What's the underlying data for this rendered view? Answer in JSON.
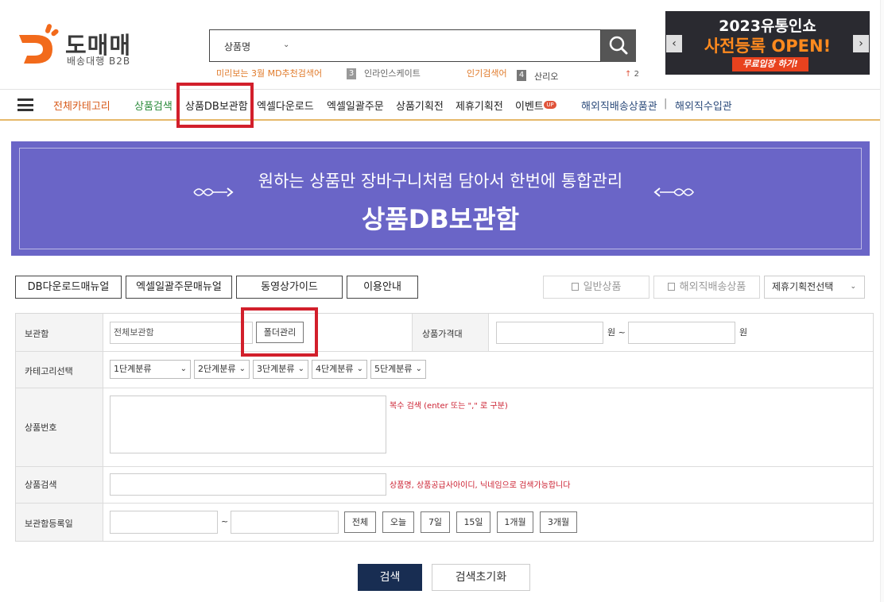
{
  "header": {
    "logo_title": "도매매",
    "logo_subtitle": "배송대행 B2B",
    "search_category": "상품명",
    "md_text": "미리보는 3월 MD추천검색어",
    "rank3_num": "3",
    "rank3_text": "인라인스케이트",
    "popular_label": "인기검색어",
    "rank4_num": "4",
    "rank4_text": "산리오",
    "rank4_change": "2"
  },
  "promo": {
    "line1": "2023유통인쇼",
    "line2": "사전등록 OPEN!",
    "button": "무료입장 하기!"
  },
  "nav": {
    "all": "전체카테고리",
    "search": "상품검색",
    "db": "상품DB보관함",
    "excel_download": "엑셀다운로드",
    "excel_order": "엑셀일괄주문",
    "planned": "상품기획전",
    "partner": "제휴기획전",
    "event": "이벤트",
    "event_badge": "UP",
    "overseas": "해외직배송상품관",
    "separator": "|",
    "import": "해외직수입관"
  },
  "banner": {
    "subtitle": "원하는 상품만 장바구니처럼 담아서 한번에 통합관리",
    "title": "상품DB보관함"
  },
  "buttons": {
    "db_manual": "DB다운로드매뉴얼",
    "excel_manual": "엑셀일괄주문매뉴얼",
    "video_guide": "동영상가이드",
    "guide": "이용안내",
    "normal_product": "일반상품",
    "overseas_product": "해외직배송상품",
    "partner_select": "제휴기획전선택"
  },
  "form": {
    "storage_label": "보관함",
    "storage_value": "전체보관함",
    "folder_button": "폴더관리",
    "price_label": "상품가격대",
    "won1": "원 ~",
    "won2": "원",
    "category_label": "카테고리선택",
    "cat1": "1단계분류",
    "cat2": "2단계분류",
    "cat3": "3단계분류",
    "cat4": "4단계분류",
    "cat5": "5단계분류",
    "product_no_label": "상품번호",
    "multi_search_note": "복수 검색 (enter 또는 \",\" 로 구분)",
    "product_search_label": "상품검색",
    "product_search_note": "상품명, 상품공급사아이디, 닉네임으로 검색가능합니다",
    "reg_date_label": "보관함등록일",
    "tilde": "~",
    "range_all": "전체",
    "range_today": "오늘",
    "range_7": "7일",
    "range_15": "15일",
    "range_1m": "1개월",
    "range_3m": "3개월"
  },
  "actions": {
    "search": "검색",
    "reset": "검색초기화"
  }
}
